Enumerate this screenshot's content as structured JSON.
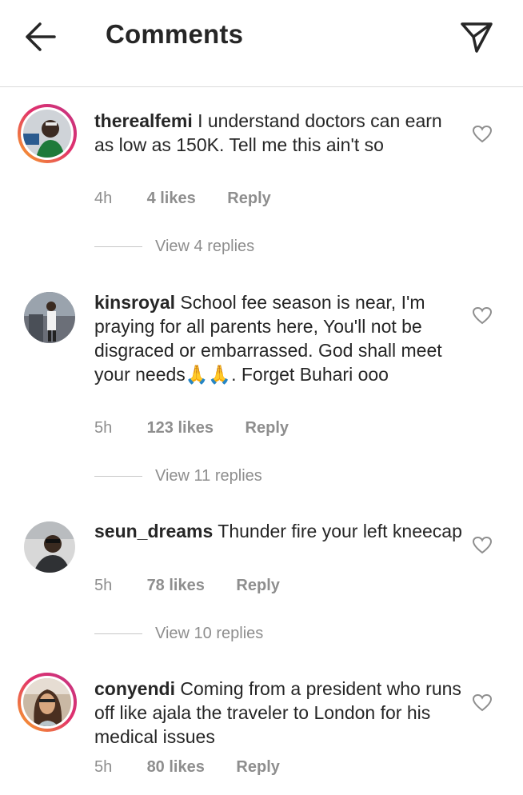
{
  "header": {
    "title": "Comments"
  },
  "comments": [
    {
      "username": "therealfemi",
      "text": "I understand doctors can earn as low as 150K. Tell me this ain't so",
      "time": "4h",
      "likes": "4 likes",
      "reply": "Reply",
      "view_replies": "View 4 replies"
    },
    {
      "username": "kinsroyal",
      "text": "School fee season is near, I'm praying for all parents here, You'll not be disgraced or embarrassed. God shall meet your needs🙏🙏. Forget Buhari ooo",
      "time": "5h",
      "likes": "123 likes",
      "reply": "Reply",
      "view_replies": "View 11 replies"
    },
    {
      "username": "seun_dreams",
      "text": "Thunder fire your left kneecap",
      "time": "5h",
      "likes": "78 likes",
      "reply": "Reply",
      "view_replies": "View 10 replies"
    },
    {
      "username": "conyendi",
      "text": "Coming from a president who runs off like ajala the traveler to London for his medical issues",
      "time": "5h",
      "likes": "80 likes",
      "reply": "Reply"
    }
  ],
  "icons": {
    "back": "arrow-left-icon",
    "send": "paper-plane-icon",
    "like": "heart-outline-icon"
  }
}
